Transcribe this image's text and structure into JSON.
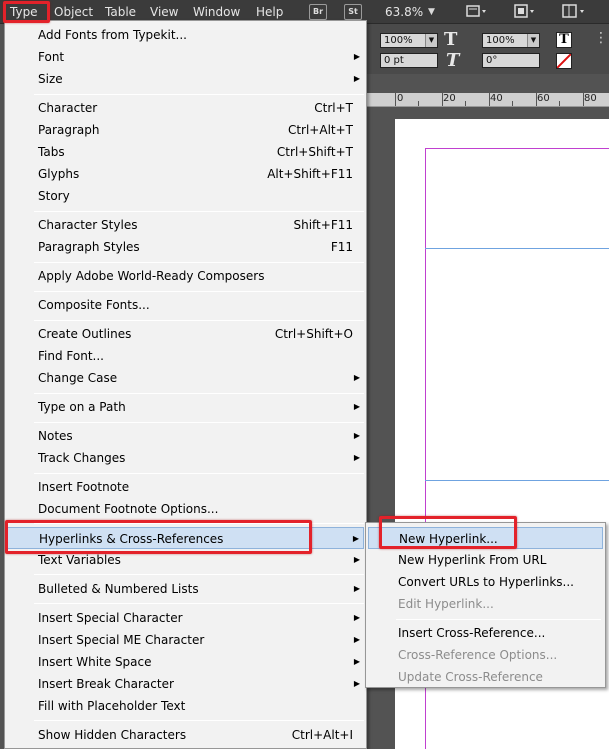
{
  "menubar": {
    "items": [
      "Type",
      "Object",
      "Table",
      "View",
      "Window",
      "Help"
    ],
    "badges": [
      "Br",
      "St"
    ],
    "zoom": "63.8%"
  },
  "control_panel": {
    "scale_x": "100%",
    "scale_y": "100%",
    "tracking": "0 pt",
    "skew": "0°"
  },
  "ruler": {
    "labels": [
      "0",
      "20",
      "40",
      "60",
      "80"
    ]
  },
  "type_menu": {
    "items": [
      {
        "label": "Add Fonts from Typekit...",
        "shortcut": "",
        "submenu": false
      },
      {
        "label": "Font",
        "shortcut": "",
        "submenu": true
      },
      {
        "label": "Size",
        "shortcut": "",
        "submenu": true
      },
      {
        "label": "Character",
        "shortcut": "Ctrl+T",
        "submenu": false
      },
      {
        "label": "Paragraph",
        "shortcut": "Ctrl+Alt+T",
        "submenu": false
      },
      {
        "label": "Tabs",
        "shortcut": "Ctrl+Shift+T",
        "submenu": false
      },
      {
        "label": "Glyphs",
        "shortcut": "Alt+Shift+F11",
        "submenu": false
      },
      {
        "label": "Story",
        "shortcut": "",
        "submenu": false
      },
      {
        "label": "Character Styles",
        "shortcut": "Shift+F11",
        "submenu": false
      },
      {
        "label": "Paragraph Styles",
        "shortcut": "F11",
        "submenu": false
      },
      {
        "label": "Apply Adobe World-Ready Composers",
        "shortcut": "",
        "submenu": false
      },
      {
        "label": "Composite Fonts...",
        "shortcut": "",
        "submenu": false
      },
      {
        "label": "Create Outlines",
        "shortcut": "Ctrl+Shift+O",
        "submenu": false
      },
      {
        "label": "Find Font...",
        "shortcut": "",
        "submenu": false
      },
      {
        "label": "Change Case",
        "shortcut": "",
        "submenu": true
      },
      {
        "label": "Type on a Path",
        "shortcut": "",
        "submenu": true
      },
      {
        "label": "Notes",
        "shortcut": "",
        "submenu": true
      },
      {
        "label": "Track Changes",
        "shortcut": "",
        "submenu": true
      },
      {
        "label": "Insert Footnote",
        "shortcut": "",
        "submenu": false
      },
      {
        "label": "Document Footnote Options...",
        "shortcut": "",
        "submenu": false
      },
      {
        "label": "Hyperlinks & Cross-References",
        "shortcut": "",
        "submenu": true
      },
      {
        "label": "Text Variables",
        "shortcut": "",
        "submenu": true
      },
      {
        "label": "Bulleted & Numbered Lists",
        "shortcut": "",
        "submenu": true
      },
      {
        "label": "Insert Special Character",
        "shortcut": "",
        "submenu": true
      },
      {
        "label": "Insert Special ME Character",
        "shortcut": "",
        "submenu": true
      },
      {
        "label": "Insert White Space",
        "shortcut": "",
        "submenu": true
      },
      {
        "label": "Insert Break Character",
        "shortcut": "",
        "submenu": true
      },
      {
        "label": "Fill with Placeholder Text",
        "shortcut": "",
        "submenu": false
      },
      {
        "label": "Show Hidden Characters",
        "shortcut": "Ctrl+Alt+I",
        "submenu": false
      }
    ]
  },
  "hyperlinks_submenu": {
    "items": [
      {
        "label": "New Hyperlink...",
        "enabled": true
      },
      {
        "label": "New Hyperlink From URL",
        "enabled": true
      },
      {
        "label": "Convert URLs to Hyperlinks...",
        "enabled": true
      },
      {
        "label": "Edit Hyperlink...",
        "enabled": false
      },
      {
        "label": "Insert Cross-Reference...",
        "enabled": true
      },
      {
        "label": "Cross-Reference Options...",
        "enabled": false
      },
      {
        "label": "Update Cross-Reference",
        "enabled": false
      }
    ]
  },
  "colors": {
    "highlight": "#cfe0f3",
    "annotation_red": "#e3222a",
    "margin_guide": "#c040d0",
    "ruler_guide": "#6fa3e0"
  },
  "icons": {
    "submenu_arrow": "▶",
    "dropdown_arrow": "▼"
  }
}
